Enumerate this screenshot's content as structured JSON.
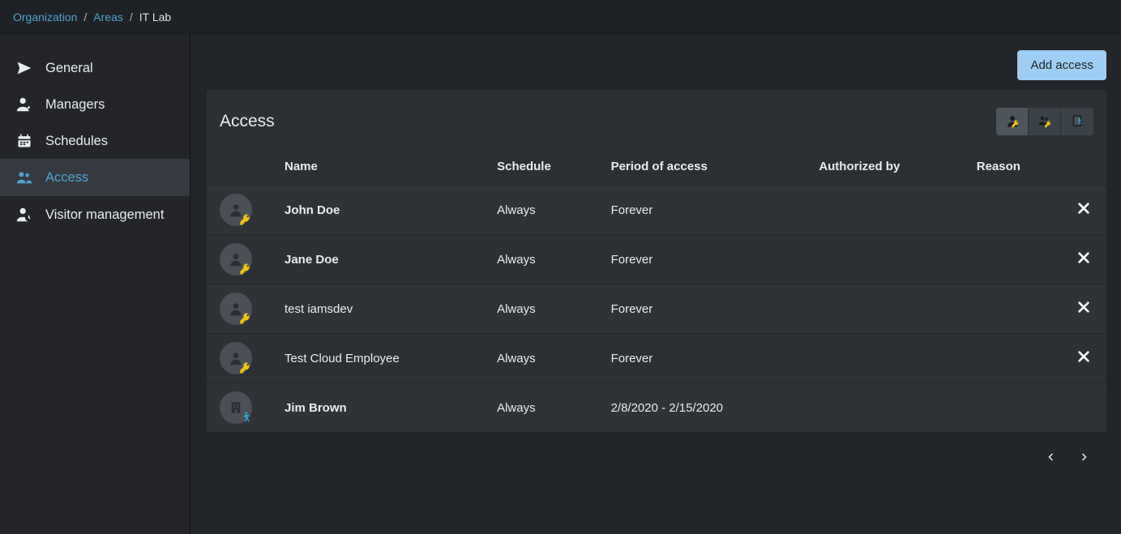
{
  "breadcrumb": {
    "org": "Organization",
    "areas": "Areas",
    "current": "IT Lab"
  },
  "sidebar": {
    "items": [
      {
        "label": "General"
      },
      {
        "label": "Managers"
      },
      {
        "label": "Schedules"
      },
      {
        "label": "Access"
      },
      {
        "label": "Visitor management"
      }
    ]
  },
  "actions": {
    "add_access": "Add access"
  },
  "panel": {
    "title": "Access",
    "columns": {
      "name": "Name",
      "schedule": "Schedule",
      "period": "Period of access",
      "authorized": "Authorized by",
      "reason": "Reason"
    },
    "rows": [
      {
        "name": "John Doe",
        "bold": true,
        "schedule": "Always",
        "period": "Forever",
        "authorized": "",
        "reason": "",
        "removable": true,
        "avatar": "key"
      },
      {
        "name": "Jane Doe",
        "bold": true,
        "schedule": "Always",
        "period": "Forever",
        "authorized": "",
        "reason": "",
        "removable": true,
        "avatar": "key"
      },
      {
        "name": "test iamsdev",
        "bold": false,
        "schedule": "Always",
        "period": "Forever",
        "authorized": "",
        "reason": "",
        "removable": true,
        "avatar": "key"
      },
      {
        "name": "Test Cloud Employee",
        "bold": false,
        "schedule": "Always",
        "period": "Forever",
        "authorized": "",
        "reason": "",
        "removable": true,
        "avatar": "key"
      },
      {
        "name": "Jim Brown",
        "bold": true,
        "schedule": "Always",
        "period": "2/8/2020 - 2/15/2020",
        "authorized": "",
        "reason": "",
        "removable": false,
        "avatar": "visitor"
      }
    ]
  }
}
